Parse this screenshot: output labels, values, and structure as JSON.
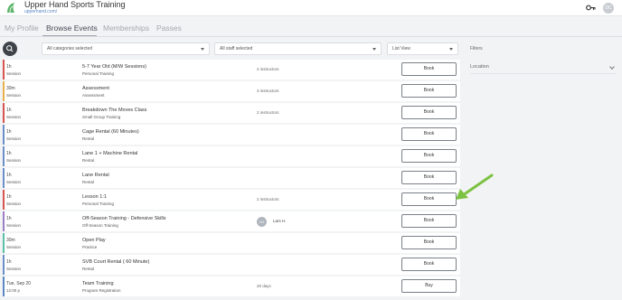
{
  "header": {
    "title": "Upper Hand Sports Training",
    "url": "upperhand.com/",
    "user_initials": "DC",
    "accent_color": "#5db56a"
  },
  "tabs": [
    {
      "label": "My Profile",
      "active": false
    },
    {
      "label": "Browse Events",
      "active": true
    },
    {
      "label": "Memberships",
      "active": false
    },
    {
      "label": "Passes",
      "active": false
    }
  ],
  "filter_bar": {
    "categories": "All categories selected",
    "staff": "All staff selected",
    "view": "List View"
  },
  "filters_panel": {
    "title": "Filters",
    "location_label": "Location"
  },
  "events": [
    {
      "duration": "1h",
      "type": "Session",
      "title": "5-7 Year Old (M/W Sessions)",
      "category": "Personal Training",
      "info": "2 instructors",
      "action": "Book",
      "color": "#d9534f"
    },
    {
      "duration": "30m",
      "type": "Session",
      "title": "Assessment",
      "category": "Assessment",
      "info": "3 instructors",
      "action": "Book",
      "color": "#e8b04a"
    },
    {
      "duration": "1h",
      "type": "Session",
      "title": "Breakdown The Moves Class",
      "category": "Small Group Training",
      "info": "2 instructors",
      "action": "Book",
      "color": "#d9534f"
    },
    {
      "duration": "1h",
      "type": "Session",
      "title": "Cage Rental (60 Minutes)",
      "category": "Rental",
      "info": "",
      "action": "Book",
      "color": "#6b8fc9"
    },
    {
      "duration": "1h",
      "type": "Session",
      "title": "Lane 1 + Machine Rental",
      "category": "Rental",
      "info": "",
      "action": "Book",
      "color": "#6b8fc9"
    },
    {
      "duration": "1h",
      "type": "Session",
      "title": "Lane Rental",
      "category": "Rental",
      "info": "",
      "action": "Book",
      "color": "#6b8fc9"
    },
    {
      "duration": "1h",
      "type": "Session",
      "title": "Lesson 1:1",
      "category": "Personal Training",
      "info": "2 instructors",
      "action": "Book",
      "color": "#d9534f"
    },
    {
      "duration": "1h",
      "type": "Session",
      "title": "Off-Season Training - Defensive Skills",
      "category": "Off-Season Training",
      "staff_initials": "LH",
      "staff_name": "Lars H.",
      "action": "Book",
      "color": "#9b7fc4"
    },
    {
      "duration": "30m",
      "type": "Session",
      "title": "Open Play",
      "category": "Practice",
      "info": "",
      "action": "Book",
      "color": "#5bc0a8"
    },
    {
      "duration": "1h",
      "type": "Session",
      "title": "SVB Court Rental ( 60 Minute)",
      "category": "Rental",
      "info": "",
      "action": "Book",
      "color": "#6b8fc9"
    },
    {
      "duration": "Tue, Sep 20",
      "type": "12:00 p",
      "title": "Team Training",
      "category": "Program Registration",
      "info": "20 days",
      "action": "Buy",
      "color": "#5b87c5"
    }
  ]
}
